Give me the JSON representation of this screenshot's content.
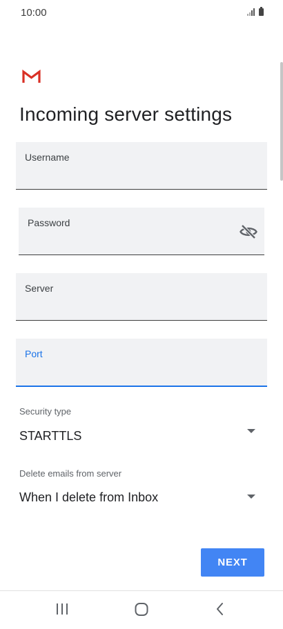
{
  "status_bar": {
    "time": "10:00",
    "icons": [
      "signal-icon",
      "battery-icon"
    ]
  },
  "app": {
    "logo": "gmail-logo",
    "brand_color": "#d93025"
  },
  "page": {
    "title": "Incoming server settings"
  },
  "form": {
    "username": {
      "label": "Username",
      "value": ""
    },
    "password": {
      "label": "Password",
      "value": "",
      "toggle_icon": "eye-off-icon"
    },
    "server": {
      "label": "Server",
      "value": ""
    },
    "port": {
      "label": "Port",
      "value": "",
      "focused": true
    }
  },
  "security_type": {
    "label": "Security type",
    "value": "STARTTLS"
  },
  "delete_emails": {
    "label": "Delete emails from server",
    "value": "When I delete from Inbox"
  },
  "actions": {
    "next_label": "NEXT"
  },
  "nav_bar": {
    "buttons": [
      "recent-apps-icon",
      "home-icon",
      "back-icon"
    ]
  },
  "colors": {
    "accent": "#1a73e8",
    "button": "#4285f4",
    "field_bg": "#f1f2f4"
  }
}
